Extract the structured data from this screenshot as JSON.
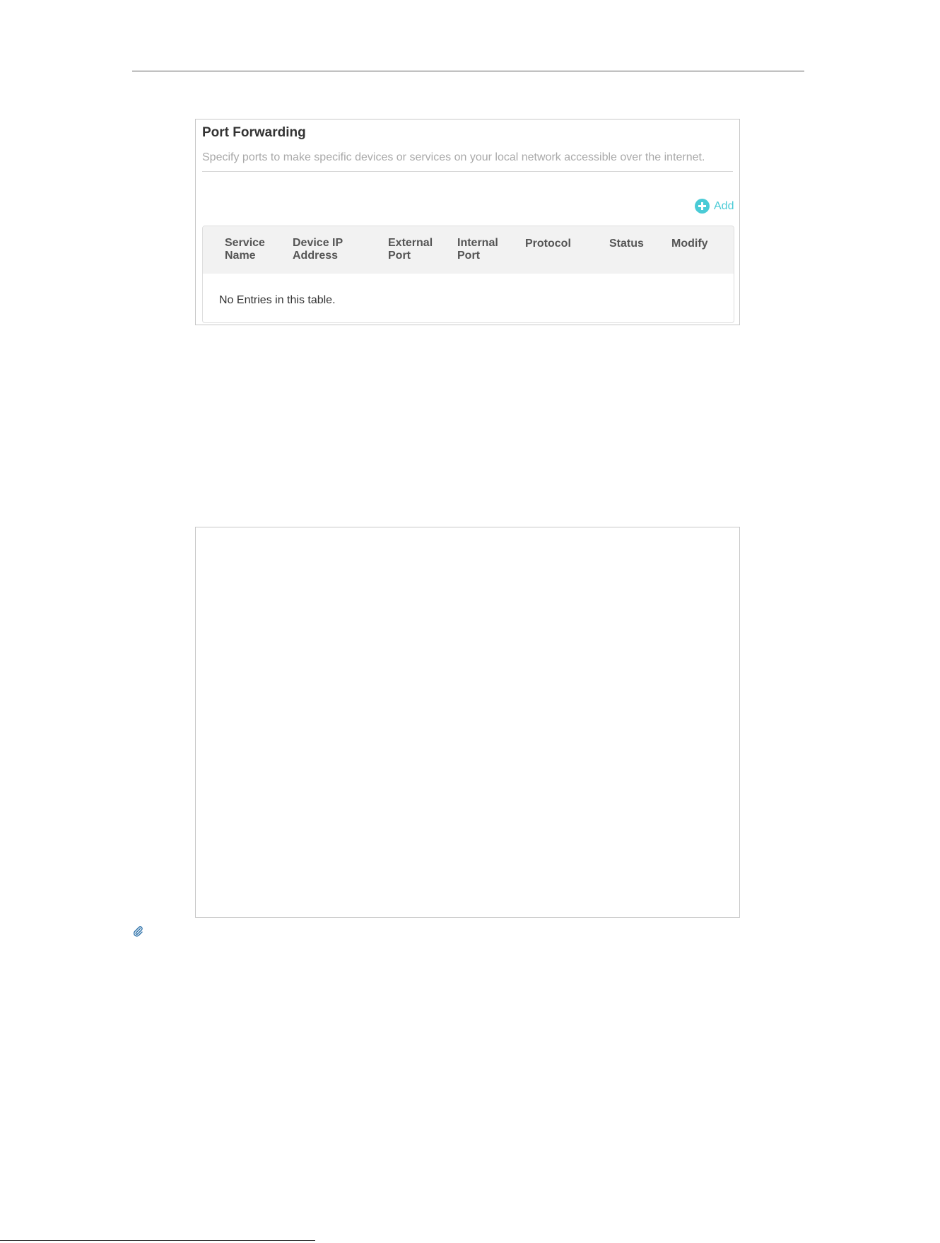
{
  "port_forwarding": {
    "title": "Port Forwarding",
    "description": "Specify ports to make specific devices or services on your local network accessible over the internet.",
    "add_label": "Add",
    "table": {
      "columns": [
        {
          "line1": "Service",
          "line2": "Name"
        },
        {
          "line1": "Device IP",
          "line2": "Address"
        },
        {
          "line1": "External",
          "line2": "Port"
        },
        {
          "line1": "Internal",
          "line2": "Port"
        },
        {
          "line1": "Protocol",
          "line2": ""
        },
        {
          "line1": "Status",
          "line2": ""
        },
        {
          "line1": "Modify",
          "line2": ""
        }
      ],
      "empty_message": "No Entries in this table."
    }
  },
  "colors": {
    "accent": "#4acbd6",
    "header_bg": "#f2f2f2",
    "muted_text": "#a9a9a9"
  },
  "icons": {
    "add": "plus-circle-icon",
    "note": "paperclip-icon"
  }
}
